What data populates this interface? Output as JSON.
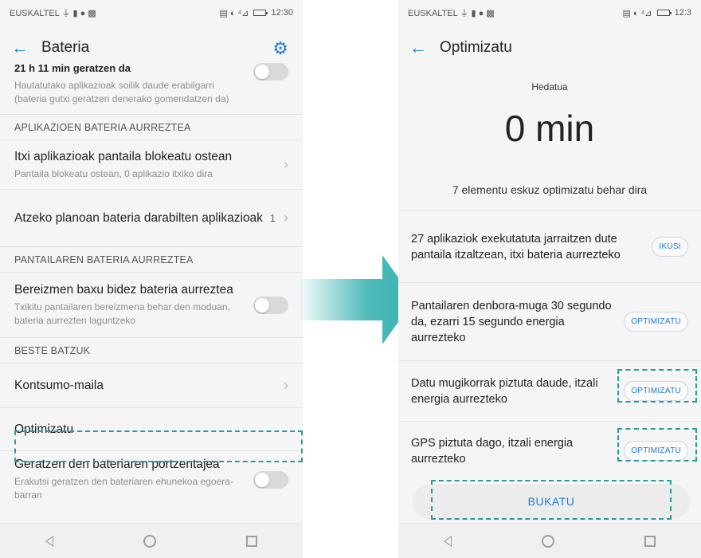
{
  "colors": {
    "accent": "#1f7bd9",
    "highlight": "#2a9d9a",
    "arrow": "#3bb3b2"
  },
  "left": {
    "status": {
      "carrier": "EUSKALTEL ⏚ ▮ ● ▩",
      "icons": "▤ ◐ ⁴⊿",
      "time": "12:30"
    },
    "title": "Bateria",
    "partial_row": {
      "main": "21 h 11 min geratzen da",
      "sub": "Hautatutako aplikazioak soilik daude erabilgarri (bateria gutxi geratzen denerako gomendatzen da)"
    },
    "sections": [
      {
        "header": "APLIKAZIOEN BATERIA AURREZTEA",
        "rows": [
          {
            "main": "Itxi aplikazioak pantaila blokeatu ostean",
            "sub": "Pantaila blokeatu ostean, 0 aplikazio itxiko dira"
          },
          {
            "main": "Atzeko planoan bateria darabilten aplikazioak",
            "count": "1"
          }
        ]
      },
      {
        "header": "PANTAILAREN BATERIA AURREZTEA",
        "rows": [
          {
            "main": "Bereizmen baxu bidez bateria aurreztea",
            "sub": "Txikitu pantailaren bereizmena behar den moduan, bateria aurrezten laguntzeko"
          }
        ]
      },
      {
        "header": "BESTE BATZUK",
        "rows": [
          {
            "main": "Kontsumo-maila"
          },
          {
            "main": "Optimizatu"
          },
          {
            "main": "Geratzen den bateriaren portzentajea",
            "sub": "Erakutsi geratzen den bateriaren ehunekoa egoera-barran"
          }
        ]
      }
    ]
  },
  "right": {
    "status": {
      "carrier": "EUSKALTEL ⏚ ▮ ● ▩",
      "icons": "▤ ◐ ⁴⊿",
      "time": "12:3"
    },
    "title": "Optimizatu",
    "hero": {
      "label": "Hedatua",
      "value": "0 min"
    },
    "pending": "7 elementu eskuz optimizatu behar dira",
    "items": [
      {
        "desc": "27 aplikaziok exekutatuta jarraitzen dute pantaila itzaltzean, itxi bateria aurrezteko",
        "button": "IKUSI"
      },
      {
        "desc": "Pantailaren denbora-muga 30 segundo da, ezarri 15 segundo energia aurrezteko",
        "button": "OPTIMIZATU"
      },
      {
        "desc": "Datu mugikorrak piztuta daude, itzali energia aurrezteko",
        "button": "OPTIMIZATU"
      },
      {
        "desc": "GPS piztuta dago, itzali energia aurrezteko",
        "button": "OPTIMIZATU"
      }
    ],
    "finish": "BUKATU"
  }
}
